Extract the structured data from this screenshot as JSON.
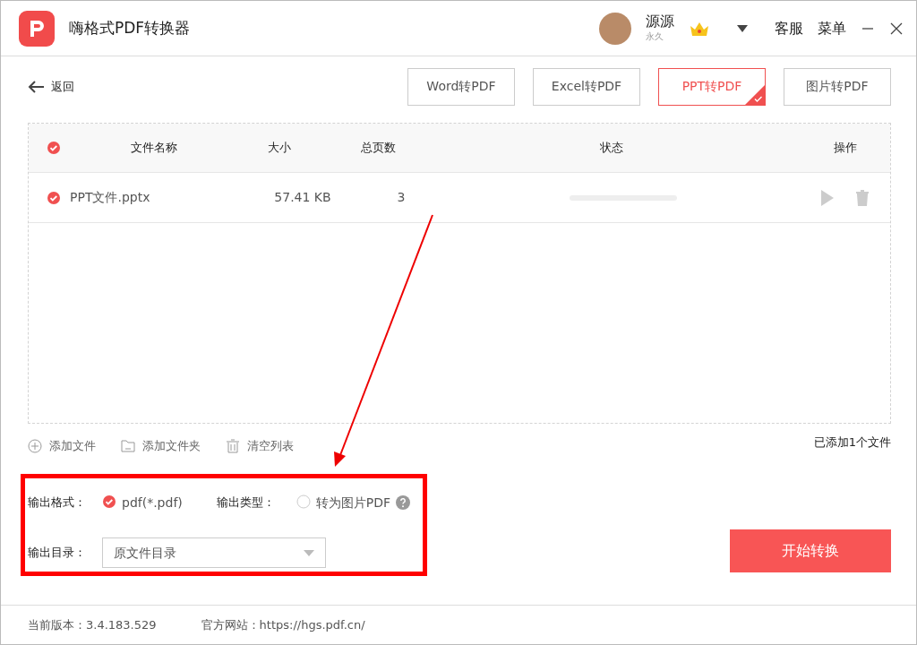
{
  "window": {
    "title": "嗨格式PDF转换器"
  },
  "user": {
    "name": "源源",
    "subtitle": "永久"
  },
  "header_links": [
    "客服",
    "菜单"
  ],
  "back": "返回",
  "tabs": [
    {
      "label": "Word转PDF",
      "selected": false
    },
    {
      "label": "Excel转PDF",
      "selected": false
    },
    {
      "label": "PPT转PDF",
      "selected": true
    },
    {
      "label": "图片转PDF",
      "selected": false
    }
  ],
  "table": {
    "all_checked": true,
    "columns": [
      "文件名称",
      "大小",
      "总页数",
      "状态",
      "操作"
    ],
    "rows": [
      {
        "name": "PPT文件.pptx",
        "size": "57.41 KB",
        "pages": "3",
        "checked": true,
        "level": 0
      }
    ]
  },
  "actions": [
    {
      "kind": "add-file",
      "label": "添加文件"
    },
    {
      "kind": "add-folder",
      "label": "添加文件夹"
    },
    {
      "kind": "clear",
      "label": "清空列表"
    }
  ],
  "file_count": "已添加1个文件",
  "output": {
    "format_label": "输出格式：",
    "format": {
      "label": "pdf(*.pdf)",
      "checked": true
    },
    "type_label": "输出类型：",
    "type": {
      "label": "转为图片PDF",
      "checked": false
    },
    "dir_label": "输出目录：",
    "dir_value": "原文件目录"
  },
  "start_button": "开始转换",
  "footer": {
    "version": "当前版本：3.4.183.529",
    "website": "官方网站：https://hgs.pdf.cn/"
  }
}
